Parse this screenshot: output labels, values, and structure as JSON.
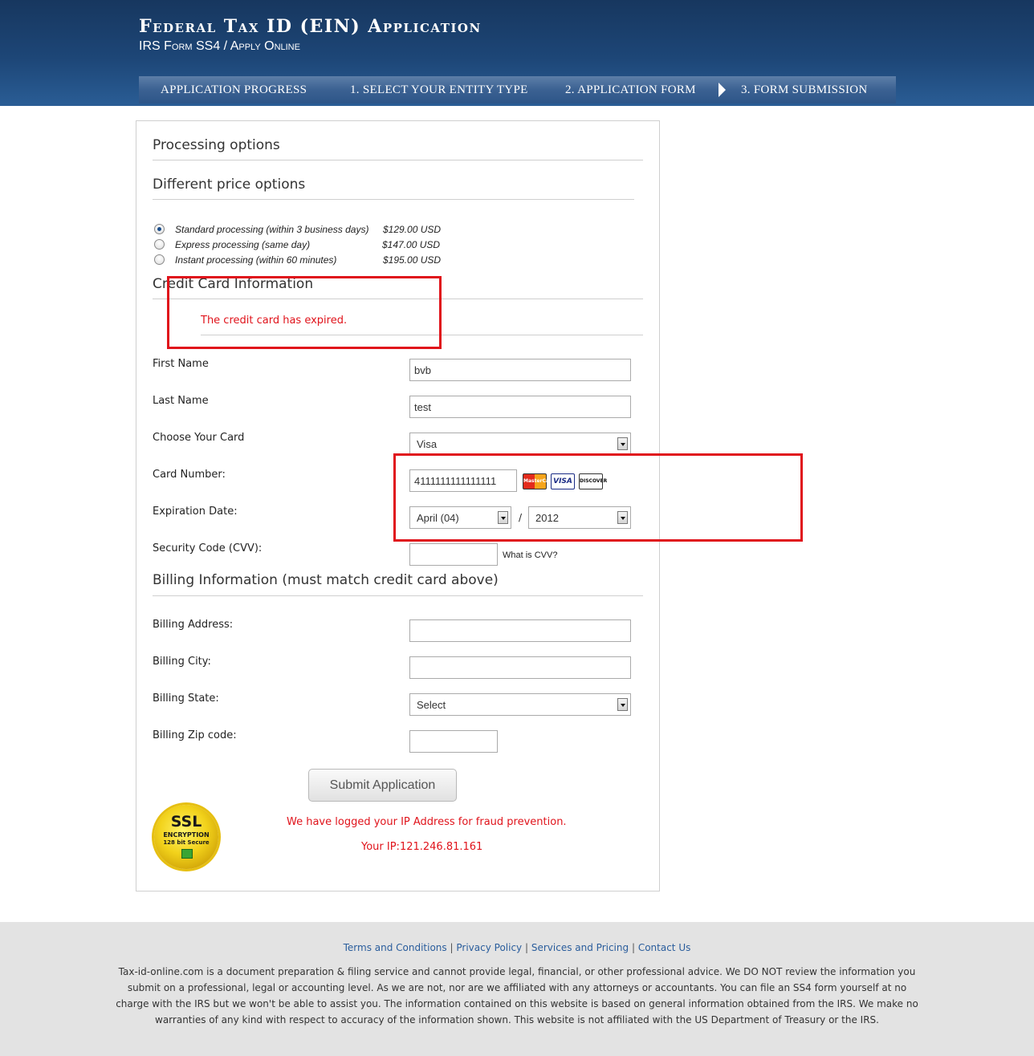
{
  "header": {
    "title": "Federal Tax ID (EIN) Application",
    "subtitle": "IRS Form SS4 / Apply Online",
    "nav": [
      "APPLICATION PROGRESS",
      "1. SELECT YOUR ENTITY TYPE",
      "2. APPLICATION FORM",
      "3. FORM SUBMISSION"
    ]
  },
  "processing": {
    "title": "Processing options",
    "price_title": "Different price options",
    "options": [
      {
        "label": "Standard processing (within 3 business days)",
        "price": "$129.00 USD",
        "selected": true
      },
      {
        "label": "Express processing (same day)",
        "price": "$147.00 USD",
        "selected": false
      },
      {
        "label": "Instant processing (within 60 minutes)",
        "price": "$195.00 USD",
        "selected": false
      }
    ]
  },
  "credit_card": {
    "title": "Credit Card Information",
    "error": "The credit card has expired.",
    "first_name_label": "First Name",
    "first_name_value": "bvb",
    "last_name_label": "Last Name",
    "last_name_value": "test",
    "card_type_label": "Choose Your Card",
    "card_type_value": "Visa",
    "card_number_label": "Card Number:",
    "card_number_value": "4111111111111111",
    "card_logos": [
      "MasterCard",
      "VISA",
      "DISCOVER"
    ],
    "expiration_label": "Expiration Date:",
    "exp_month": "April (04)",
    "exp_separator": "/",
    "exp_year": "2012",
    "cvv_label": "Security Code (CVV):",
    "cvv_value": "",
    "cvv_help": "What is CVV?"
  },
  "billing": {
    "title": "Billing Information (must match credit card above)",
    "address_label": "Billing Address:",
    "city_label": "Billing City:",
    "state_label": "Billing State:",
    "state_value": "Select",
    "zip_label": "Billing Zip code:"
  },
  "submit": {
    "label": "Submit Application",
    "fraud_notice": "We have logged your IP Address for fraud prevention.",
    "ip_text": "Your IP:121.246.81.161"
  },
  "ssl_badge": {
    "line1": "SSL",
    "line2": "ENCRYPTION",
    "line3": "128 bit Secure"
  },
  "footer": {
    "links": [
      "Terms and Conditions",
      "Privacy Policy",
      "Services and Pricing",
      "Contact Us"
    ],
    "separator": "|",
    "disclaimer": "Tax-id-online.com is a document preparation & filing service and cannot provide legal, financial, or other professional advice. We DO NOT review the information you submit on a professional, legal or accounting level. As we are not, nor are we affiliated with any attorneys or accountants. You can file an SS4 form yourself at no charge with the IRS but we won't be able to assist you. The information contained on this website is based on general information obtained from the IRS. We make no warranties of any kind with respect to accuracy of the information shown. This website is not affiliated with the US Department of Treasury or the IRS."
  },
  "colors": {
    "header_bg": "#1d4677",
    "error_red": "#e0131b",
    "link_blue": "#2a5d9c",
    "footer_bg": "#e3e3e3"
  }
}
